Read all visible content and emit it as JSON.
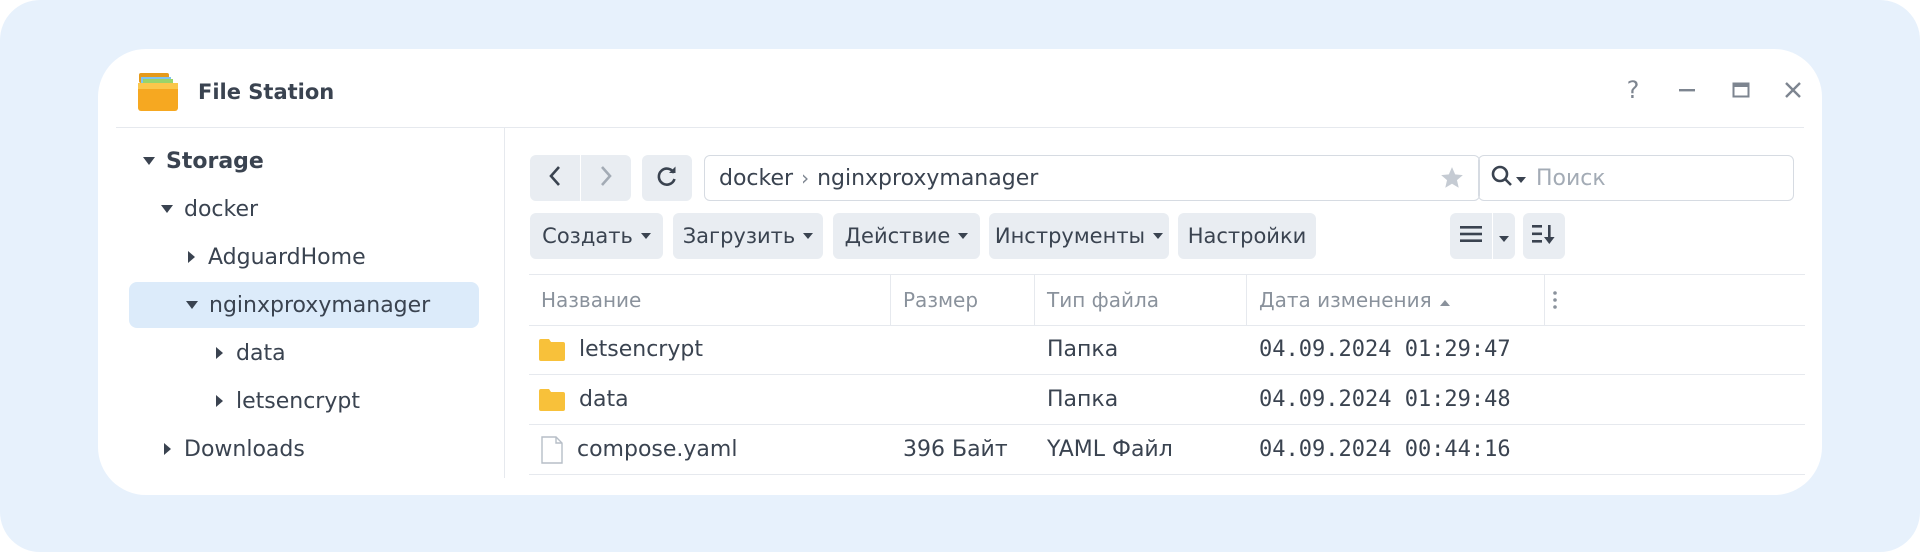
{
  "window": {
    "title": "File Station"
  },
  "sidebar": {
    "items": [
      {
        "label": "Storage"
      },
      {
        "label": "docker"
      },
      {
        "label": "AdguardHome"
      },
      {
        "label": "nginxproxymanager"
      },
      {
        "label": "data"
      },
      {
        "label": "letsencrypt"
      },
      {
        "label": "Downloads"
      }
    ]
  },
  "path": {
    "segments": [
      "docker",
      "nginxproxymanager"
    ]
  },
  "search": {
    "placeholder": "Поиск"
  },
  "toolbar": {
    "create_label": "Создать",
    "upload_label": "Загрузить",
    "action_label": "Действие",
    "tools_label": "Инструменты",
    "settings_label": "Настройки"
  },
  "table": {
    "columns": [
      "Название",
      "Размер",
      "Тип файла",
      "Дата изменения"
    ],
    "rows": [
      {
        "name": "letsencrypt",
        "size": "",
        "type": "Папка",
        "modified": "04.09.2024 01:29:47",
        "icon": "folder-icon"
      },
      {
        "name": "data",
        "size": "",
        "type": "Папка",
        "modified": "04.09.2024 01:29:48",
        "icon": "folder-icon"
      },
      {
        "name": "compose.yaml",
        "size": "396 Байт",
        "type": "YAML Файл",
        "modified": "04.09.2024 00:44:16",
        "icon": "file-icon"
      }
    ]
  },
  "colors": {
    "backdrop": "#e7f1fc",
    "selected": "#dcebfa",
    "folder": "#f8c13a",
    "button": "#e9edf2"
  }
}
